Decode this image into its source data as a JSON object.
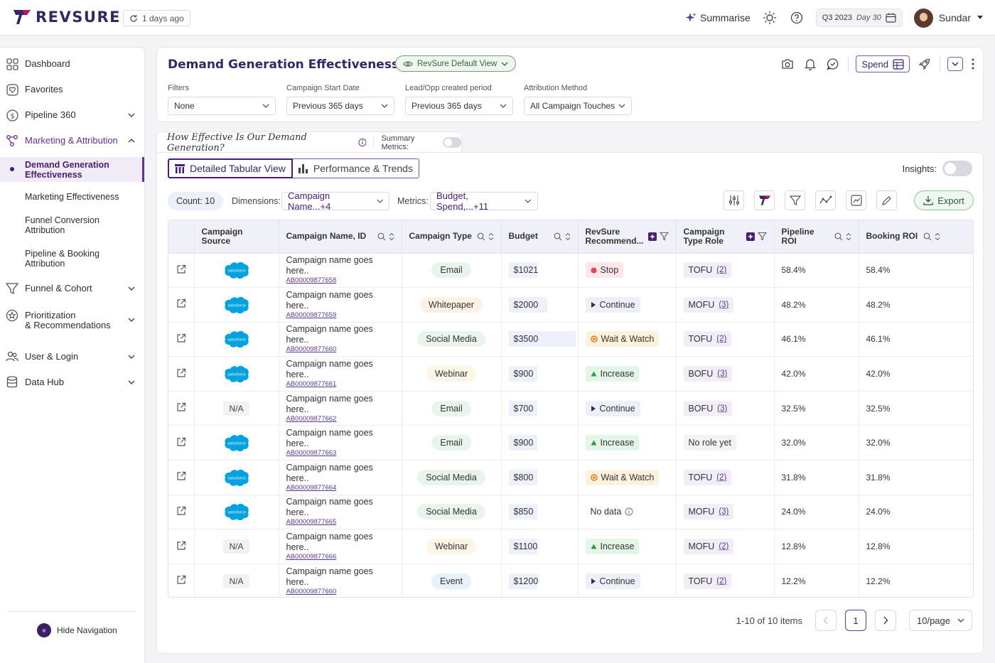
{
  "app": {
    "logo_text": "REVSURE",
    "sync_status": "1 days ago",
    "summarise_label": "Summarise",
    "quarter": "Q3 2023",
    "quarter_day": "Day 30",
    "user_name": "Sundar"
  },
  "sidebar": {
    "items": [
      {
        "label": "Dashboard"
      },
      {
        "label": "Favorites"
      },
      {
        "label": "Pipeline 360"
      },
      {
        "label": "Marketing & Attribution"
      },
      {
        "label": "Funnel & Cohort"
      },
      {
        "label": "Prioritization\n& Recommendations"
      },
      {
        "label": "User & Login"
      },
      {
        "label": "Data Hub"
      }
    ],
    "subitems": [
      {
        "label": "Demand Generation Effectiveness"
      },
      {
        "label": "Marketing Effectiveness"
      },
      {
        "label": "Funnel Conversion Attribution"
      },
      {
        "label": "Pipeline & Booking Attribution"
      }
    ],
    "hide_nav_label": "Hide Navigation"
  },
  "header": {
    "title": "Demand Generation Effectiveness",
    "view_label": "RevSure Default View",
    "spend_label": "Spend",
    "filters": [
      {
        "label": "Filters",
        "value": "None"
      },
      {
        "label": "Campaign Start Date",
        "value": "Previous 365 days"
      },
      {
        "label": "Lead/Opp created period",
        "value": "Previous 365 days"
      },
      {
        "label": "Attribution Method",
        "value": "All Campaign Touches"
      }
    ]
  },
  "summary": {
    "question": "How Effective Is Our Demand Generation?",
    "metrics_label": "Summary Metrics:"
  },
  "main": {
    "tab_detailed": "Detailed Tabular View",
    "tab_performance": "Performance & Trends",
    "insights_label": "Insights:",
    "count_label": "Count: 10",
    "dimensions_label": "Dimensions:",
    "dimensions_value": "Campaign Name...+4",
    "metrics_label": "Metrics:",
    "metrics_value": "Budget, Spend,...+11",
    "export_label": "Export"
  },
  "table": {
    "columns": [
      "Campaign Source",
      "Campaign Name, ID",
      "Campaign Type",
      "Budget",
      "RevSure Recommend...",
      "Campaign Type Role",
      "Pipeline ROI",
      "Booking ROI"
    ],
    "salesforce_text": "salesforce",
    "rows": [
      {
        "source": "salesforce",
        "name": "Campaign name goes here..",
        "id": "AB00009877658",
        "type": "Email",
        "budget": "$1021",
        "budget_frac": 0.29,
        "rec": "Stop",
        "rec_kind": "stop",
        "role": "TOFU",
        "role_count": "(2)",
        "pipeline_roi": "58.4%",
        "booking_roi": "58.4%"
      },
      {
        "source": "salesforce",
        "name": "Campaign name goes here..",
        "id": "AB00009877659",
        "type": "Whitepaper",
        "budget": "$2000",
        "budget_frac": 0.57,
        "rec": "Continue",
        "rec_kind": "continue",
        "role": "MOFU",
        "role_count": "(3)",
        "pipeline_roi": "48.2%",
        "booking_roi": "48.2%"
      },
      {
        "source": "salesforce",
        "name": "Campaign name goes here..",
        "id": "AB00009877660",
        "type": "Social Media",
        "budget": "$3500",
        "budget_frac": 1.0,
        "rec": "Wait & Watch",
        "rec_kind": "wait",
        "role": "TOFU",
        "role_count": "(2)",
        "pipeline_roi": "46.1%",
        "booking_roi": "46.1%"
      },
      {
        "source": "salesforce",
        "name": "Campaign name goes here..",
        "id": "AB00009877661",
        "type": "Webinar",
        "budget": "$900",
        "budget_frac": 0.26,
        "rec": "Increase",
        "rec_kind": "increase",
        "role": "BOFU",
        "role_count": "(3)",
        "pipeline_roi": "42.0%",
        "booking_roi": "42.0%"
      },
      {
        "source": "N/A",
        "name": "Campaign name goes here..",
        "id": "AB00009877662",
        "type": "Email",
        "budget": "$700",
        "budget_frac": 0.2,
        "rec": "Continue",
        "rec_kind": "continue",
        "role": "BOFU",
        "role_count": "(3)",
        "pipeline_roi": "32.5%",
        "booking_roi": "32.5%"
      },
      {
        "source": "salesforce",
        "name": "Campaign name goes here..",
        "id": "AB00009877663",
        "type": "Email",
        "budget": "$900",
        "budget_frac": 0.26,
        "rec": "Increase",
        "rec_kind": "increase",
        "role": "No role yet",
        "role_count": "",
        "pipeline_roi": "32.0%",
        "booking_roi": "32.0%"
      },
      {
        "source": "salesforce",
        "name": "Campaign name goes here..",
        "id": "AB00009877664",
        "type": "Social Media",
        "budget": "$800",
        "budget_frac": 0.23,
        "rec": "Wait & Watch",
        "rec_kind": "wait",
        "role": "TOFU",
        "role_count": "(2)",
        "pipeline_roi": "31.8%",
        "booking_roi": "31.8%"
      },
      {
        "source": "salesforce",
        "name": "Campaign name goes here..",
        "id": "AB00009877665",
        "type": "Social Media",
        "budget": "$850",
        "budget_frac": 0.24,
        "rec": "No data",
        "rec_kind": "nodata",
        "role": "MOFU",
        "role_count": "(3)",
        "pipeline_roi": "24.0%",
        "booking_roi": "24.0%"
      },
      {
        "source": "N/A",
        "name": "Campaign name goes here..",
        "id": "AB00009877666",
        "type": "Webinar",
        "budget": "$1100",
        "budget_frac": 0.31,
        "rec": "Increase",
        "rec_kind": "increase",
        "role": "MOFU",
        "role_count": "(2)",
        "pipeline_roi": "12.8%",
        "booking_roi": "12.8%"
      },
      {
        "source": "N/A",
        "name": "Campaign name goes here..",
        "id": "AB00009877660",
        "type": "Event",
        "budget": "$1200",
        "budget_frac": 0.34,
        "rec": "Continue",
        "rec_kind": "continue",
        "role": "TOFU",
        "role_count": "(2)",
        "pipeline_roi": "12.2%",
        "booking_roi": "12.2%"
      }
    ]
  },
  "pagination": {
    "summary": "1-10 of 10 items",
    "current_page": "1",
    "page_size": "10/page"
  },
  "colors": {
    "brand": "#3a2563",
    "accent": "#6b2f8f",
    "email_pill": "#e8f5ec",
    "whitepaper_pill": "#fdf1e6",
    "social_pill": "#e9f5ec",
    "webinar_pill": "#fdf5e6",
    "event_pill": "#e6f1fb"
  }
}
